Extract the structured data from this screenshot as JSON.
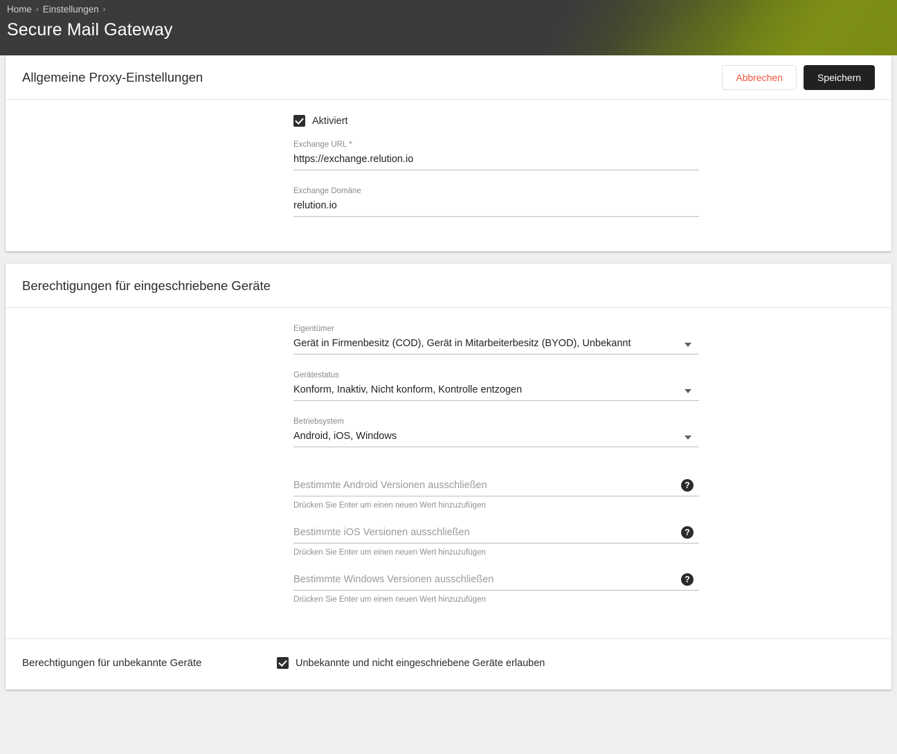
{
  "header": {
    "breadcrumb": [
      {
        "label": "Home",
        "sep": "›"
      },
      {
        "label": "Einstellungen",
        "sep": "›"
      }
    ],
    "title": "Secure Mail Gateway",
    "accent_color": "#7b8b15",
    "background_color": "#3b3b3b"
  },
  "card_proxy": {
    "title": "Allgemeine Proxy-Einstellungen",
    "cancel_label": "Abbrechen",
    "save_label": "Speichern",
    "cancel_color": "#f0553f",
    "save_bg": "#212121",
    "enabled_checkbox": {
      "label": "Aktiviert",
      "checked": true
    },
    "fields": [
      {
        "label": "Exchange URL *",
        "value": "https://exchange.relution.io"
      },
      {
        "label": "Exchange Domäne",
        "value": "relution.io"
      }
    ]
  },
  "card_permissions": {
    "title": "Berechtigungen für eingeschriebene Geräte",
    "selects": [
      {
        "label": "Eigentümer",
        "value": "Gerät in Firmenbesitz (COD), Gerät in Mitarbeiterbesitz (BYOD), Unbekannt"
      },
      {
        "label": "Gerätestatus",
        "value": "Konform, Inaktiv, Nicht konform, Kontrolle entzogen"
      },
      {
        "label": "Betriebsystem",
        "value": "Android, iOS, Windows"
      }
    ],
    "chip_inputs": [
      {
        "placeholder": "Bestimmte Android Versionen ausschließen",
        "hint": "Drücken Sie Enter um einen neuen Wert hinzuzufügen",
        "help": "?"
      },
      {
        "placeholder": "Bestimmte iOS Versionen ausschließen",
        "hint": "Drücken Sie Enter um einen neuen Wert hinzuzufügen",
        "help": "?"
      },
      {
        "placeholder": "Bestimmte Windows Versionen ausschließen",
        "hint": "Drücken Sie Enter um einen neuen Wert hinzuzufügen",
        "help": "?"
      }
    ],
    "unknown_section": {
      "label": "Berechtigungen für unbekannte Geräte",
      "checkbox_label": "Unbekannte und nicht eingeschriebene Geräte erlauben",
      "checked": true
    }
  }
}
